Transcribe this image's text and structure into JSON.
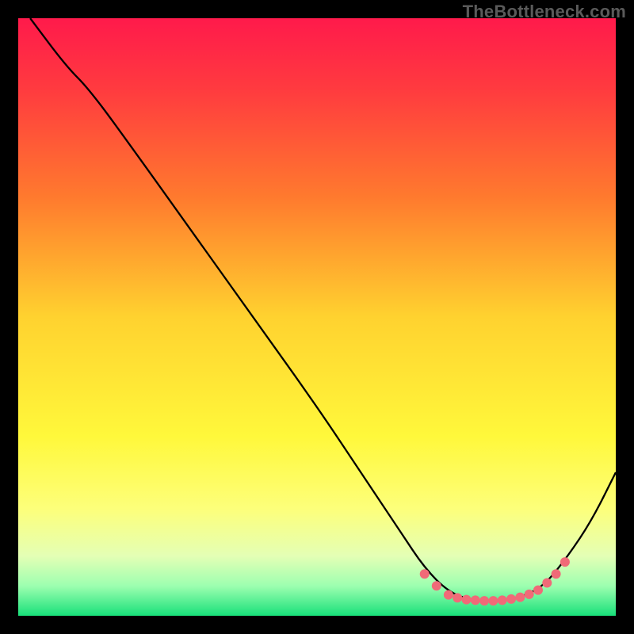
{
  "watermark": "TheBottleneck.com",
  "chart_data": {
    "type": "line",
    "title": "",
    "xlabel": "",
    "ylabel": "",
    "xlim": [
      0,
      100
    ],
    "ylim": [
      0,
      100
    ],
    "grid": false,
    "background_gradient": {
      "stops": [
        {
          "offset": 0.0,
          "color": "#ff1a4b"
        },
        {
          "offset": 0.12,
          "color": "#ff3b3f"
        },
        {
          "offset": 0.3,
          "color": "#ff7a2e"
        },
        {
          "offset": 0.5,
          "color": "#ffd22f"
        },
        {
          "offset": 0.7,
          "color": "#fff83b"
        },
        {
          "offset": 0.82,
          "color": "#fdff7a"
        },
        {
          "offset": 0.9,
          "color": "#e4ffb5"
        },
        {
          "offset": 0.95,
          "color": "#9dffb0"
        },
        {
          "offset": 1.0,
          "color": "#18e07a"
        }
      ]
    },
    "series": [
      {
        "name": "curve",
        "stroke": "#000000",
        "points": [
          {
            "x": 2,
            "y": 100
          },
          {
            "x": 8,
            "y": 92
          },
          {
            "x": 12,
            "y": 88
          },
          {
            "x": 20,
            "y": 77
          },
          {
            "x": 30,
            "y": 63
          },
          {
            "x": 40,
            "y": 49
          },
          {
            "x": 50,
            "y": 35
          },
          {
            "x": 58,
            "y": 23
          },
          {
            "x": 64,
            "y": 14
          },
          {
            "x": 68,
            "y": 8
          },
          {
            "x": 72,
            "y": 4
          },
          {
            "x": 76,
            "y": 2.5
          },
          {
            "x": 80,
            "y": 2.5
          },
          {
            "x": 84,
            "y": 3
          },
          {
            "x": 88,
            "y": 5
          },
          {
            "x": 92,
            "y": 10
          },
          {
            "x": 96,
            "y": 16
          },
          {
            "x": 100,
            "y": 24
          }
        ]
      }
    ],
    "markers": {
      "color": "#f06a78",
      "radius": 6,
      "points": [
        {
          "x": 68,
          "y": 7
        },
        {
          "x": 70,
          "y": 5
        },
        {
          "x": 72,
          "y": 3.5
        },
        {
          "x": 73.5,
          "y": 3
        },
        {
          "x": 75,
          "y": 2.7
        },
        {
          "x": 76.5,
          "y": 2.6
        },
        {
          "x": 78,
          "y": 2.5
        },
        {
          "x": 79.5,
          "y": 2.5
        },
        {
          "x": 81,
          "y": 2.6
        },
        {
          "x": 82.5,
          "y": 2.8
        },
        {
          "x": 84,
          "y": 3.1
        },
        {
          "x": 85.5,
          "y": 3.6
        },
        {
          "x": 87,
          "y": 4.3
        },
        {
          "x": 88.5,
          "y": 5.5
        },
        {
          "x": 90,
          "y": 7
        },
        {
          "x": 91.5,
          "y": 9
        }
      ]
    }
  }
}
